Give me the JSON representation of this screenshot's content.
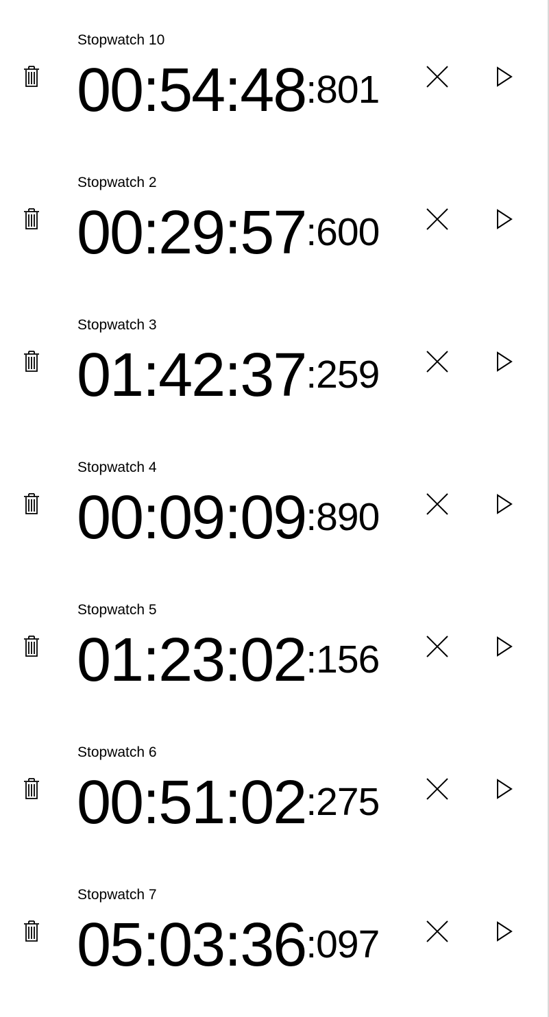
{
  "stopwatches": [
    {
      "name": "Stopwatch 10",
      "hms": "00:54:48",
      "ms": ":801"
    },
    {
      "name": "Stopwatch 2",
      "hms": "00:29:57",
      "ms": ":600"
    },
    {
      "name": "Stopwatch 3",
      "hms": "01:42:37",
      "ms": ":259"
    },
    {
      "name": "Stopwatch 4",
      "hms": "00:09:09",
      "ms": ":890"
    },
    {
      "name": "Stopwatch 5",
      "hms": "01:23:02",
      "ms": ":156"
    },
    {
      "name": "Stopwatch 6",
      "hms": "00:51:02",
      "ms": ":275"
    },
    {
      "name": "Stopwatch 7",
      "hms": "05:03:36",
      "ms": ":097"
    }
  ],
  "icons": {
    "delete": "trash-icon",
    "reset": "close-icon",
    "start": "play-icon"
  },
  "colors": {
    "background": "#ffffff",
    "foreground": "#000000"
  }
}
